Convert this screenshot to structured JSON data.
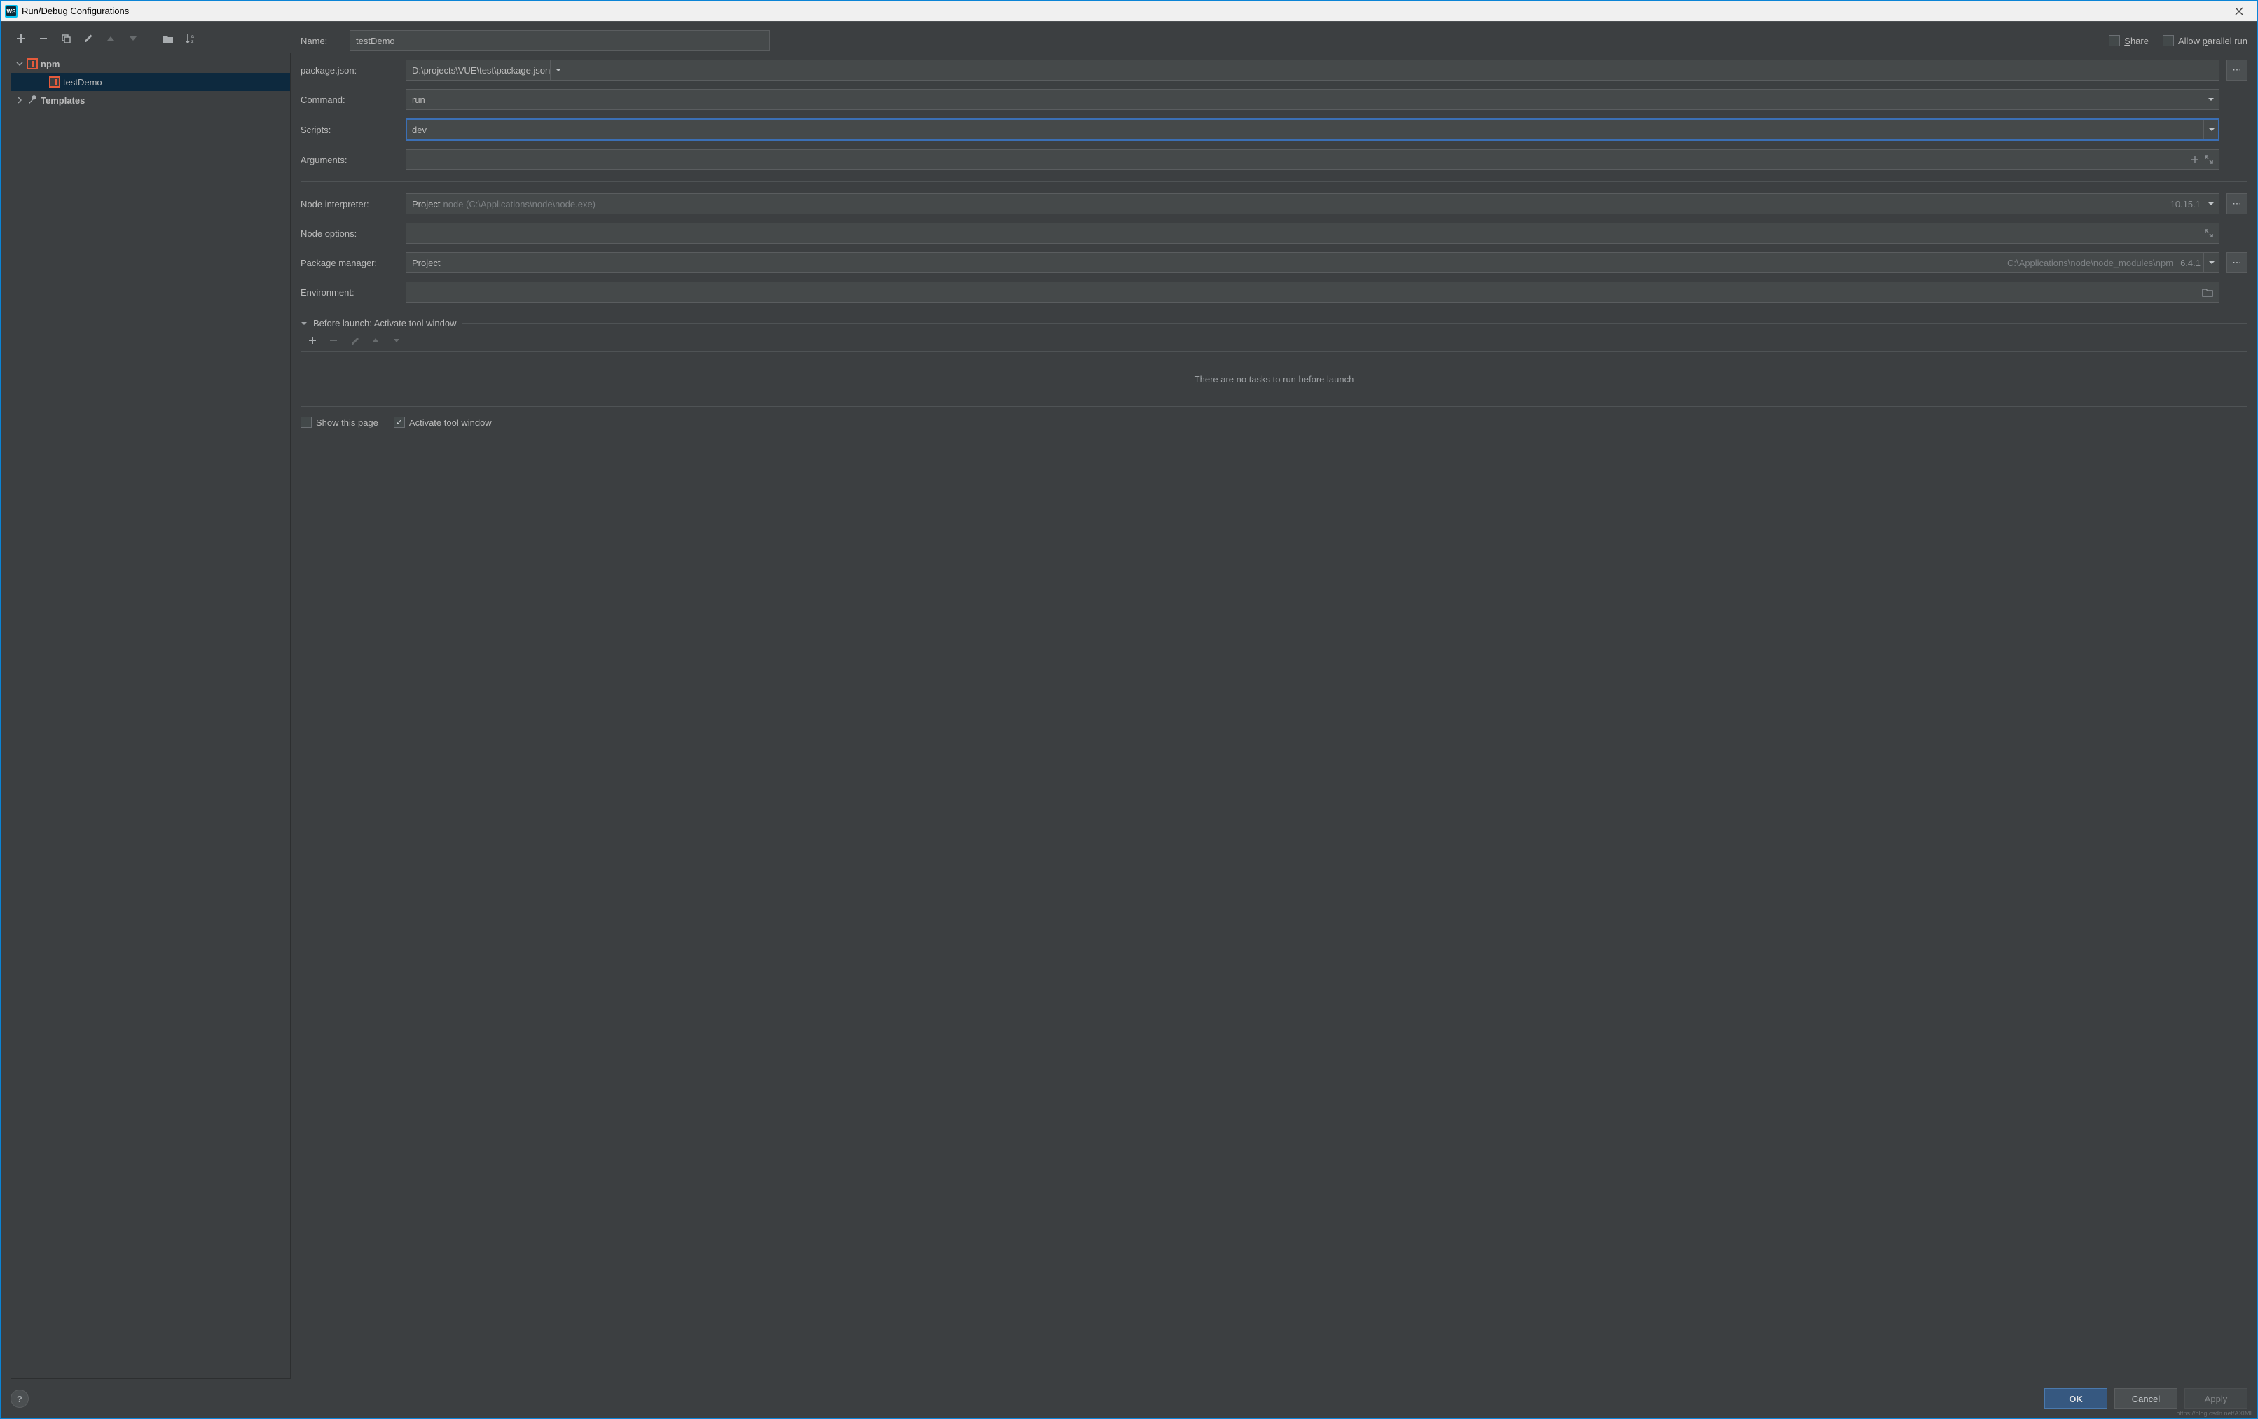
{
  "titlebar": {
    "title": "Run/Debug Configurations"
  },
  "tree": {
    "npm_label": "npm",
    "selected_config": "testDemo",
    "templates_label": "Templates"
  },
  "top": {
    "name_label": "Name:",
    "name_value": "testDemo",
    "share_label_pre": "S",
    "share_label_rest": "hare",
    "allow_parallel_pre": "Allow ",
    "allow_parallel_u": "p",
    "allow_parallel_rest": "arallel run"
  },
  "form": {
    "package_json_label": "package.json:",
    "package_json_value": "D:\\projects\\VUE\\test\\package.json",
    "command_label": "Command:",
    "command_value": "run",
    "scripts_label": "Scripts:",
    "scripts_value": "dev",
    "arguments_label": "Arguments:",
    "arguments_value": "",
    "node_interpreter_label": "Node interpreter:",
    "node_interpreter_prefix": "Project",
    "node_interpreter_ghost": "node (C:\\Applications\\node\\node.exe)",
    "node_interpreter_version": "10.15.1",
    "node_options_label": "Node options:",
    "node_options_value": "",
    "package_manager_label": "Package manager:",
    "package_manager_prefix": "Project",
    "package_manager_ghost": "C:\\Applications\\node\\node_modules\\npm",
    "package_manager_version": "6.4.1",
    "environment_label": "Environment:",
    "environment_value": ""
  },
  "before_launch": {
    "header": "Before launch: Activate tool window",
    "empty_text": "There are no tasks to run before launch",
    "show_this_page": "Show this page",
    "activate_tool_window": "Activate tool window"
  },
  "footer": {
    "ok": "OK",
    "cancel": "Cancel",
    "apply": "Apply"
  },
  "watermark": "https://blog.csdn.net/AXIMI"
}
